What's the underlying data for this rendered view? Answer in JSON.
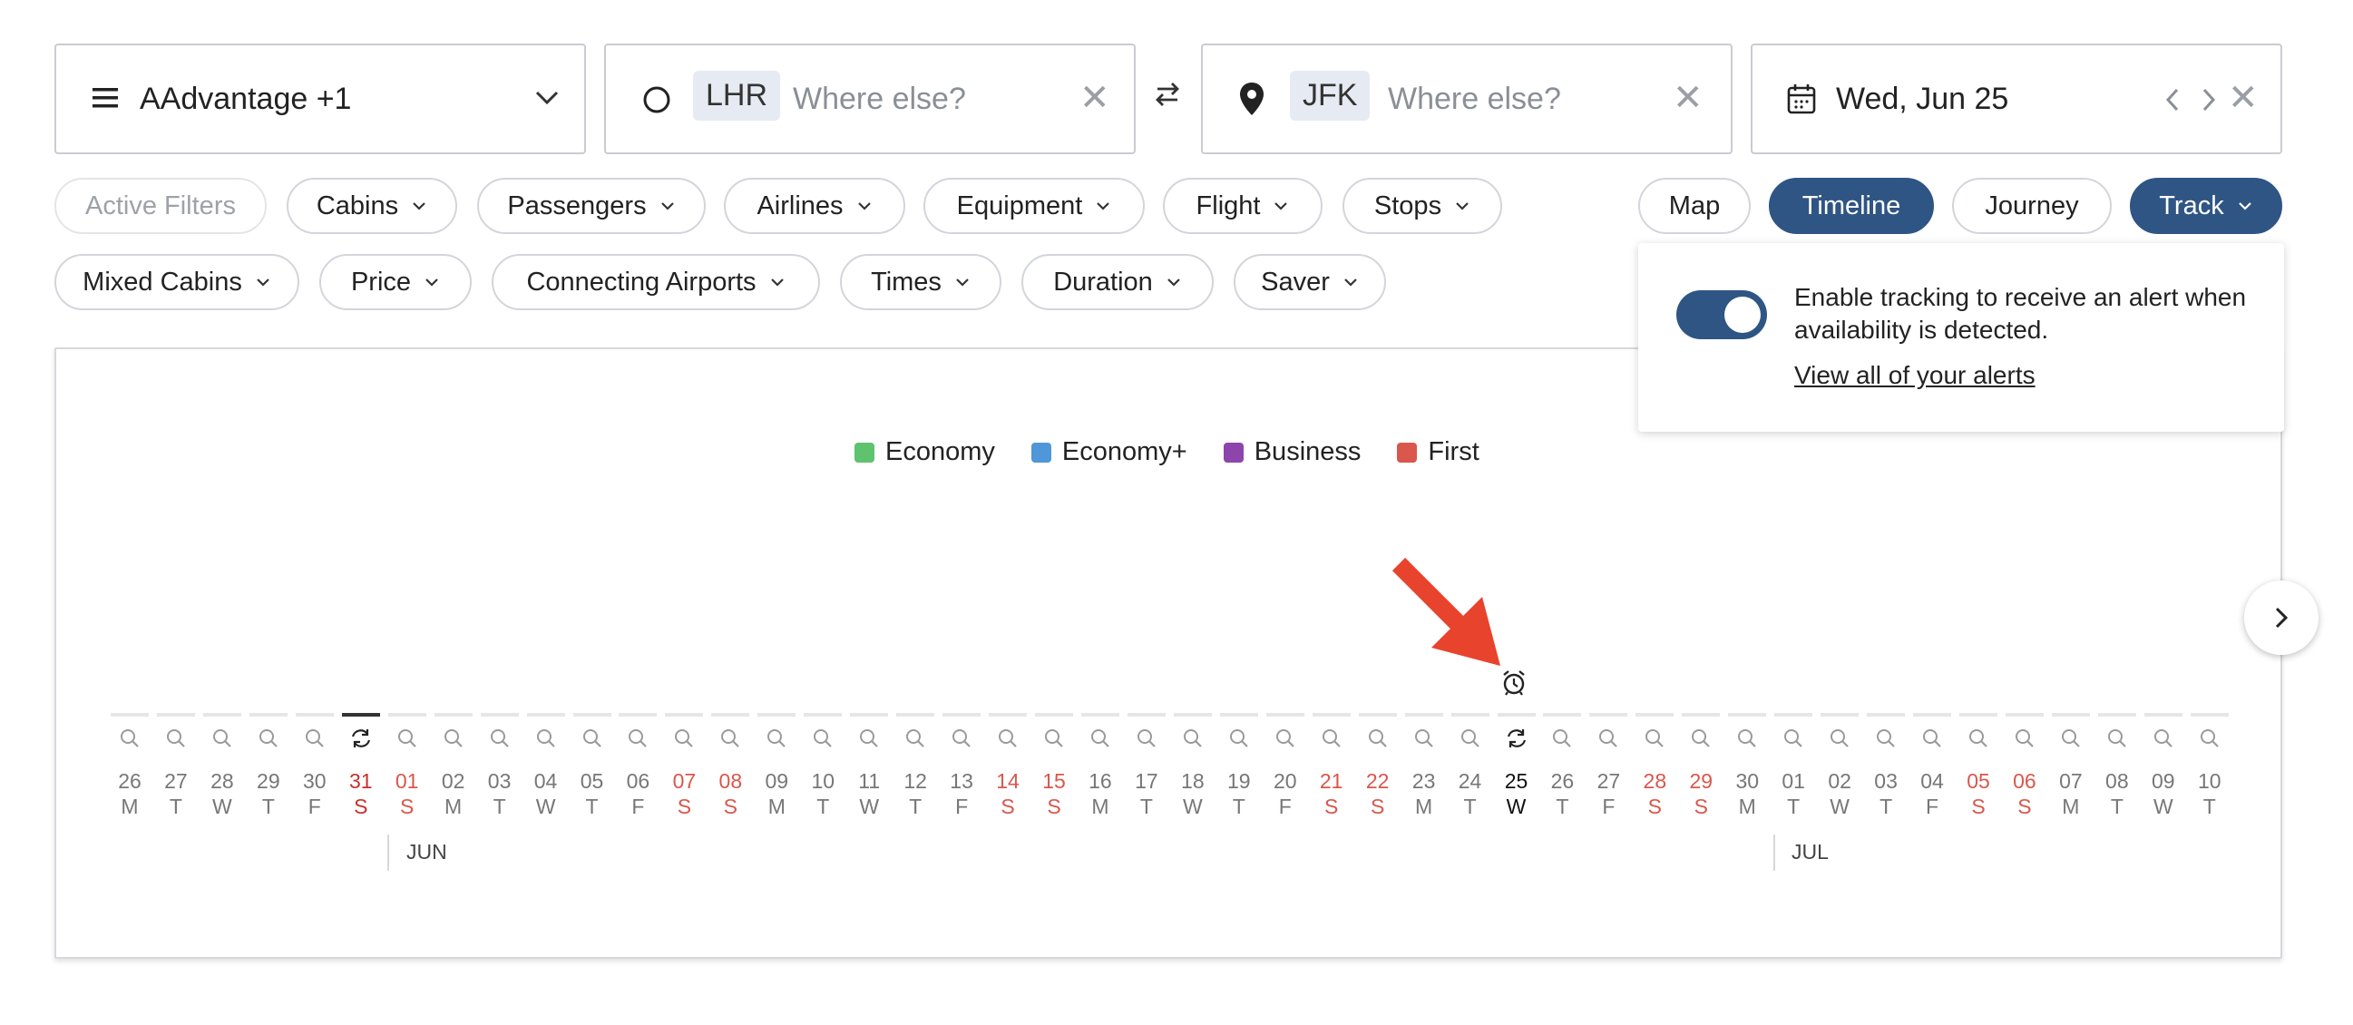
{
  "search": {
    "program": "AAdvantage +1",
    "origin_code": "LHR",
    "origin_placeholder": "Where else?",
    "destination_code": "JFK",
    "destination_placeholder": "Where else?",
    "date": "Wed, Jun 25"
  },
  "filters": {
    "row1": [
      "Active Filters",
      "Cabins",
      "Passengers",
      "Airlines",
      "Equipment",
      "Flight",
      "Stops"
    ],
    "row2": [
      "Mixed Cabins",
      "Price",
      "Connecting Airports",
      "Times",
      "Duration",
      "Saver"
    ]
  },
  "views": {
    "map": "Map",
    "timeline": "Timeline",
    "journey": "Journey",
    "track": "Track"
  },
  "track_popover": {
    "text": "Enable tracking to receive an alert when availability is detected.",
    "link": "View all of your alerts",
    "enabled": true
  },
  "legend": [
    {
      "label": "Economy",
      "color": "#5ec26f"
    },
    {
      "label": "Economy+",
      "color": "#4f97d8"
    },
    {
      "label": "Business",
      "color": "#8e44ad"
    },
    {
      "label": "First",
      "color": "#d9574c"
    }
  ],
  "timeline": {
    "days": [
      {
        "d": "26",
        "w": "M",
        "t": "n"
      },
      {
        "d": "27",
        "w": "T",
        "t": "n"
      },
      {
        "d": "28",
        "w": "W",
        "t": "n"
      },
      {
        "d": "29",
        "w": "T",
        "t": "n"
      },
      {
        "d": "30",
        "w": "F",
        "t": "n"
      },
      {
        "d": "31",
        "w": "S",
        "t": "today"
      },
      {
        "d": "01",
        "w": "S",
        "t": "we"
      },
      {
        "d": "02",
        "w": "M",
        "t": "n"
      },
      {
        "d": "03",
        "w": "T",
        "t": "n"
      },
      {
        "d": "04",
        "w": "W",
        "t": "n"
      },
      {
        "d": "05",
        "w": "T",
        "t": "n"
      },
      {
        "d": "06",
        "w": "F",
        "t": "n"
      },
      {
        "d": "07",
        "w": "S",
        "t": "we"
      },
      {
        "d": "08",
        "w": "S",
        "t": "we"
      },
      {
        "d": "09",
        "w": "M",
        "t": "n"
      },
      {
        "d": "10",
        "w": "T",
        "t": "n"
      },
      {
        "d": "11",
        "w": "W",
        "t": "n"
      },
      {
        "d": "12",
        "w": "T",
        "t": "n"
      },
      {
        "d": "13",
        "w": "F",
        "t": "n"
      },
      {
        "d": "14",
        "w": "S",
        "t": "we"
      },
      {
        "d": "15",
        "w": "S",
        "t": "we"
      },
      {
        "d": "16",
        "w": "M",
        "t": "n"
      },
      {
        "d": "17",
        "w": "T",
        "t": "n"
      },
      {
        "d": "18",
        "w": "W",
        "t": "n"
      },
      {
        "d": "19",
        "w": "T",
        "t": "n"
      },
      {
        "d": "20",
        "w": "F",
        "t": "n"
      },
      {
        "d": "21",
        "w": "S",
        "t": "we"
      },
      {
        "d": "22",
        "w": "S",
        "t": "we"
      },
      {
        "d": "23",
        "w": "M",
        "t": "n"
      },
      {
        "d": "24",
        "w": "T",
        "t": "n"
      },
      {
        "d": "25",
        "w": "W",
        "t": "sel"
      },
      {
        "d": "26",
        "w": "T",
        "t": "n"
      },
      {
        "d": "27",
        "w": "F",
        "t": "n"
      },
      {
        "d": "28",
        "w": "S",
        "t": "we"
      },
      {
        "d": "29",
        "w": "S",
        "t": "we"
      },
      {
        "d": "30",
        "w": "M",
        "t": "n"
      },
      {
        "d": "01",
        "w": "T",
        "t": "n"
      },
      {
        "d": "02",
        "w": "W",
        "t": "n"
      },
      {
        "d": "03",
        "w": "T",
        "t": "n"
      },
      {
        "d": "04",
        "w": "F",
        "t": "n"
      },
      {
        "d": "05",
        "w": "S",
        "t": "we"
      },
      {
        "d": "06",
        "w": "S",
        "t": "we"
      },
      {
        "d": "07",
        "w": "M",
        "t": "n"
      },
      {
        "d": "08",
        "w": "T",
        "t": "n"
      },
      {
        "d": "09",
        "w": "W",
        "t": "n"
      },
      {
        "d": "10",
        "w": "T",
        "t": "n"
      }
    ],
    "months": [
      "JUN",
      "JUL"
    ]
  }
}
